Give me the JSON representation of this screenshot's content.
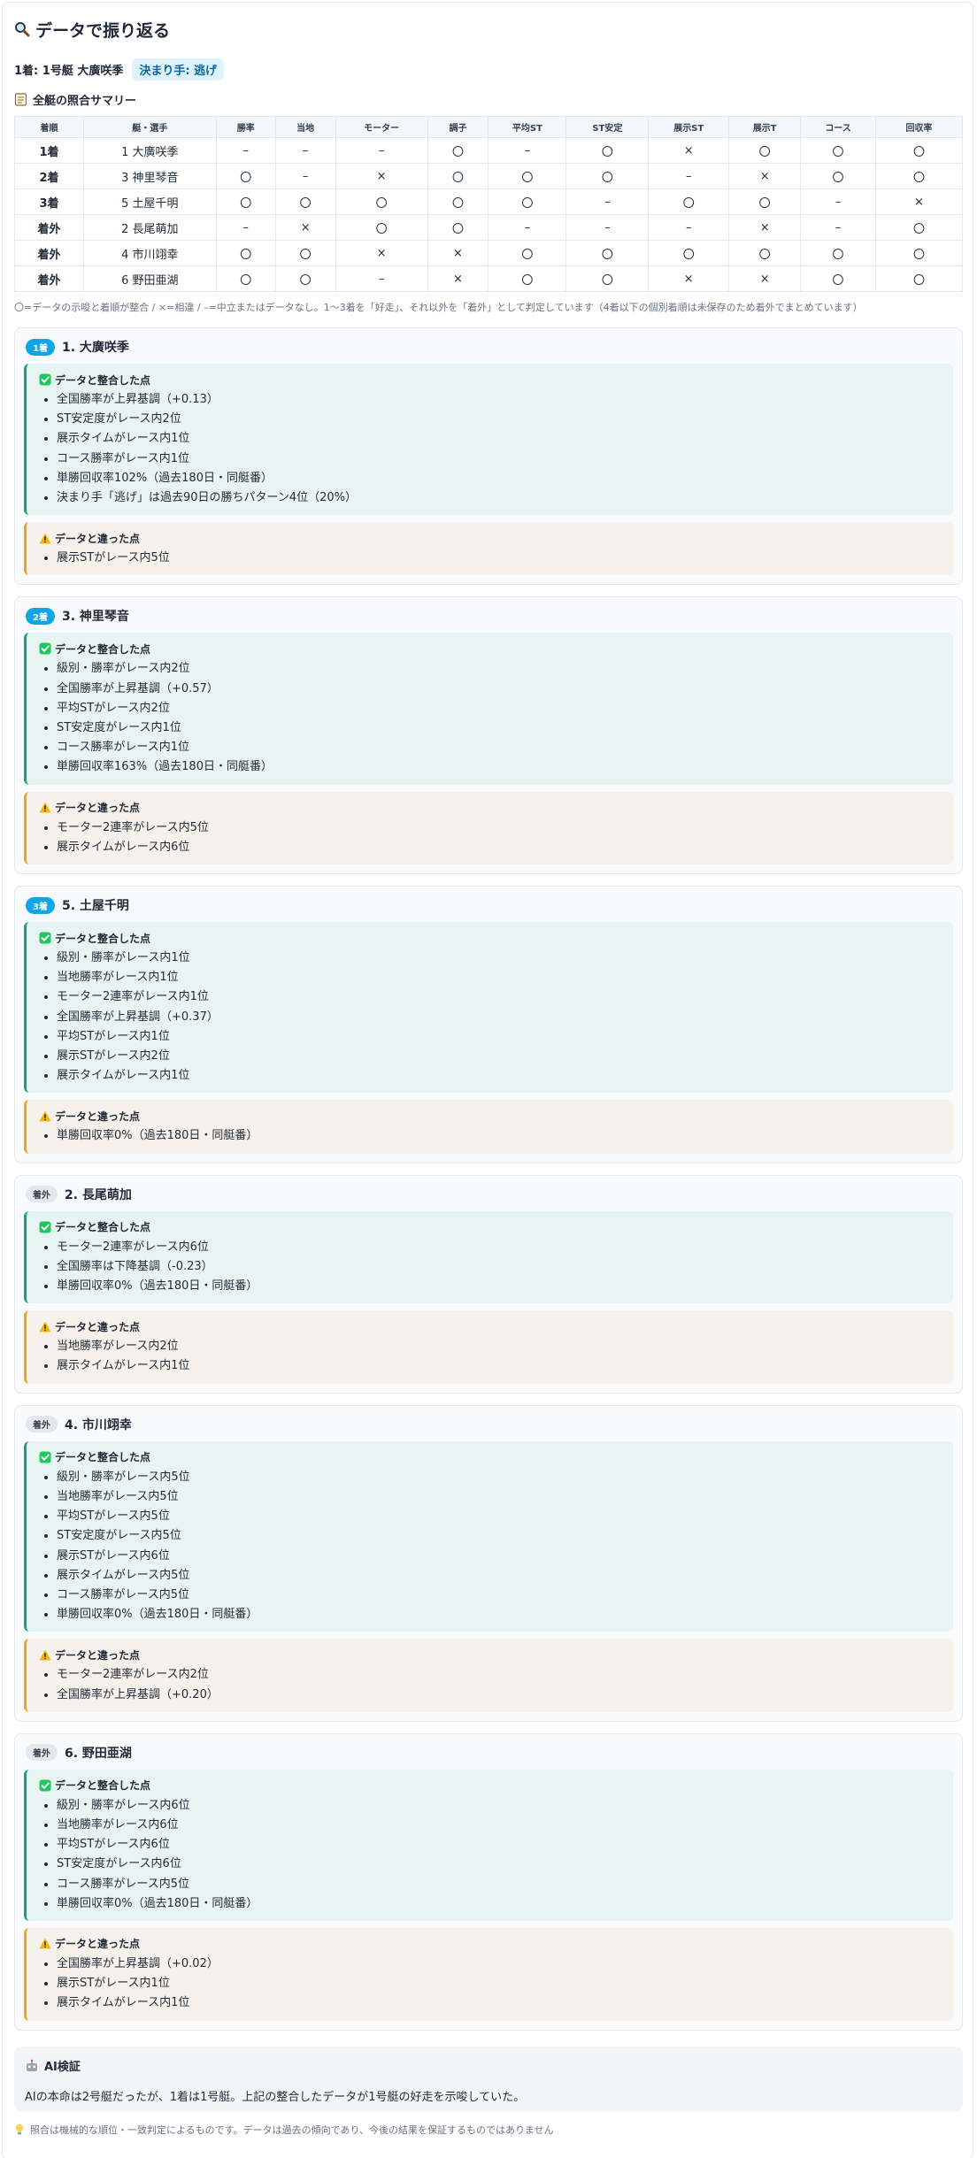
{
  "header": {
    "icon": "magnifier-icon",
    "title": "データで振り返る",
    "result_line": "1着: 1号艇 大廣咲季",
    "pattern_badge": "決まり手: 逃げ"
  },
  "summary": {
    "icon": "memo-icon",
    "title": "全艇の照合サマリー",
    "columns": [
      "着順",
      "艇・選手",
      "勝率",
      "当地",
      "モーター",
      "調子",
      "平均ST",
      "ST安定",
      "展示ST",
      "展示T",
      "コース",
      "回収率"
    ],
    "rows": [
      {
        "rank": "1着",
        "racer": "1 大廣咲季",
        "cells": [
          "–",
          "–",
          "–",
          "〇",
          "–",
          "〇",
          "×",
          "〇",
          "〇",
          "〇"
        ]
      },
      {
        "rank": "2着",
        "racer": "3 神里琴音",
        "cells": [
          "〇",
          "–",
          "×",
          "〇",
          "〇",
          "〇",
          "–",
          "×",
          "〇",
          "〇"
        ]
      },
      {
        "rank": "3着",
        "racer": "5 土屋千明",
        "cells": [
          "〇",
          "〇",
          "〇",
          "〇",
          "〇",
          "–",
          "〇",
          "〇",
          "–",
          "×"
        ]
      },
      {
        "rank": "着外",
        "racer": "2 長尾萌加",
        "cells": [
          "–",
          "×",
          "〇",
          "〇",
          "–",
          "–",
          "–",
          "×",
          "–",
          "〇"
        ]
      },
      {
        "rank": "着外",
        "racer": "4 市川翊幸",
        "cells": [
          "〇",
          "〇",
          "×",
          "×",
          "〇",
          "〇",
          "〇",
          "〇",
          "〇",
          "〇"
        ]
      },
      {
        "rank": "着外",
        "racer": "6 野田亜湖",
        "cells": [
          "〇",
          "〇",
          "–",
          "×",
          "〇",
          "〇",
          "×",
          "×",
          "〇",
          "〇"
        ]
      }
    ],
    "legend": "〇=データの示唆と着順が整合 / ×=相違 / –=中立またはデータなし。1〜3着を「好走」、それ以外を「着外」として判定しています（4着以下の個別着順は未保存のため着外でまとめています）"
  },
  "good_label": "データと整合した点",
  "warn_label": "データと違った点",
  "racers": [
    {
      "badge": "1着",
      "name": "1. 大廣咲季",
      "in": true,
      "good": [
        "全国勝率が上昇基調（+0.13）",
        "ST安定度がレース内2位",
        "展示タイムがレース内1位",
        "コース勝率がレース内1位",
        "単勝回収率102%（過去180日・同艇番）",
        "決まり手「逃げ」は過去90日の勝ちパターン4位（20%）"
      ],
      "warn": [
        "展示STがレース内5位"
      ]
    },
    {
      "badge": "2着",
      "name": "3. 神里琴音",
      "in": true,
      "good": [
        "級別・勝率がレース内2位",
        "全国勝率が上昇基調（+0.57）",
        "平均STがレース内2位",
        "ST安定度がレース内1位",
        "コース勝率がレース内1位",
        "単勝回収率163%（過去180日・同艇番）"
      ],
      "warn": [
        "モーター2連率がレース内5位",
        "展示タイムがレース内6位"
      ]
    },
    {
      "badge": "3着",
      "name": "5. 土屋千明",
      "in": true,
      "good": [
        "級別・勝率がレース内1位",
        "当地勝率がレース内1位",
        "モーター2連率がレース内1位",
        "全国勝率が上昇基調（+0.37）",
        "平均STがレース内1位",
        "展示STがレース内2位",
        "展示タイムがレース内1位"
      ],
      "warn": [
        "単勝回収率0%（過去180日・同艇番）"
      ]
    },
    {
      "badge": "着外",
      "name": "2. 長尾萌加",
      "in": false,
      "good": [
        "モーター2連率がレース内6位",
        "全国勝率は下降基調（-0.23）",
        "単勝回収率0%（過去180日・同艇番）"
      ],
      "warn": [
        "当地勝率がレース内2位",
        "展示タイムがレース内1位"
      ]
    },
    {
      "badge": "着外",
      "name": "4. 市川翊幸",
      "in": false,
      "good": [
        "級別・勝率がレース内5位",
        "当地勝率がレース内5位",
        "平均STがレース内5位",
        "ST安定度がレース内5位",
        "展示STがレース内6位",
        "展示タイムがレース内5位",
        "コース勝率がレース内5位",
        "単勝回収率0%（過去180日・同艇番）"
      ],
      "warn": [
        "モーター2連率がレース内2位",
        "全国勝率が上昇基調（+0.20）"
      ]
    },
    {
      "badge": "着外",
      "name": "6. 野田亜湖",
      "in": false,
      "good": [
        "級別・勝率がレース内6位",
        "当地勝率がレース内6位",
        "平均STがレース内6位",
        "ST安定度がレース内6位",
        "コース勝率がレース内5位",
        "単勝回収率0%（過去180日・同艇番）"
      ],
      "warn": [
        "全国勝率が上昇基調（+0.02）",
        "展示STがレース内1位",
        "展示タイムがレース内1位"
      ]
    }
  ],
  "ai": {
    "icon": "robot-icon",
    "title": "AI検証",
    "text": "AIの本命は2号艇だったが、1着は1号艇。上記の整合したデータが1号艇の好走を示唆していた。"
  },
  "disclaimer": {
    "icon": "lightbulb-icon",
    "text": "照合は機械的な順位・一致判定によるものです。データは過去の傾向であり、今後の結果を保証するものではありません"
  }
}
